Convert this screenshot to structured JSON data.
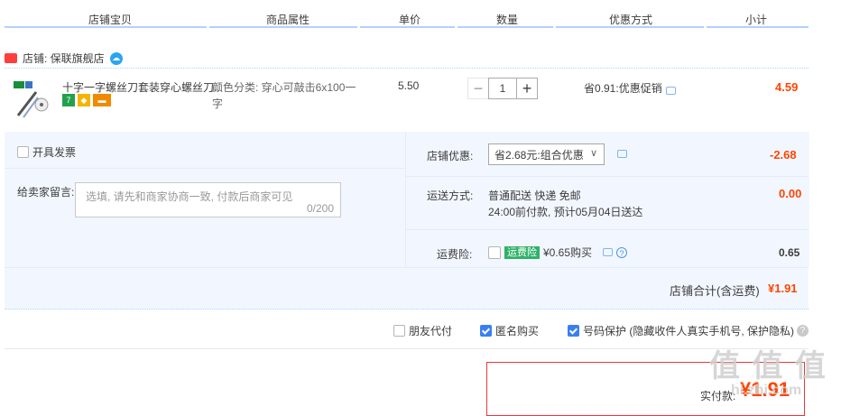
{
  "header": {
    "col_shop_item": "店铺宝贝",
    "col_attr": "商品属性",
    "col_price": "单价",
    "col_qty": "数量",
    "col_discount": "优惠方式",
    "col_subtotal": "小计"
  },
  "shop": {
    "label": "店铺: 保联旗舰店"
  },
  "item": {
    "title": "十字一字螺丝刀套装穿心螺丝刀...",
    "attr_line1": "颜色分类: 穿心可敲击6x100一",
    "attr_line2": "字",
    "price": "5.50",
    "qty_minus": "−",
    "qty_value": "1",
    "qty_plus": "+",
    "discount": "省0.91:优惠促销",
    "subtotal": "4.59",
    "badge_7": "7"
  },
  "invoice": {
    "label": "开具发票",
    "checked": false
  },
  "message": {
    "label": "给卖家留言:",
    "placeholder": "选填, 请先和商家协商一致, 付款后商家可见",
    "counter": "0/200"
  },
  "shop_discount": {
    "label": "店铺优惠:",
    "select_value": "省2.68元:组合优惠",
    "amount": "-2.68"
  },
  "shipping": {
    "label": "运送方式:",
    "line1": "普通配送 快递 免邮",
    "line2": "24:00前付款, 预计05月04日送达",
    "amount": "0.00"
  },
  "insurance": {
    "label": "运费险:",
    "badge": "运费险",
    "price_text": "¥0.65购买",
    "amount": "0.65",
    "checked": false
  },
  "shop_total": {
    "label": "店铺合计(含运费)",
    "amount": "¥1.91"
  },
  "options": {
    "friend_pay": "朋友代付",
    "friend_pay_checked": false,
    "anonymous": "匿名购买",
    "anonymous_checked": true,
    "number_protect": "号码保护 (隐藏收件人真实手机号, 保护隐私)",
    "number_protect_checked": true,
    "help_q": "?"
  },
  "final": {
    "label": "实付款:",
    "amount": "¥1.91"
  },
  "watermark": {
    "text1": "值 值 值",
    "text2": "hi.zhi.com"
  },
  "colors": {
    "accent_red": "#ff4400",
    "header_line": "#b2d1ff",
    "panel_bg": "#f2f7ff",
    "checkbox_on": "#3a7ff1",
    "insurance_green": "#2fb168"
  }
}
